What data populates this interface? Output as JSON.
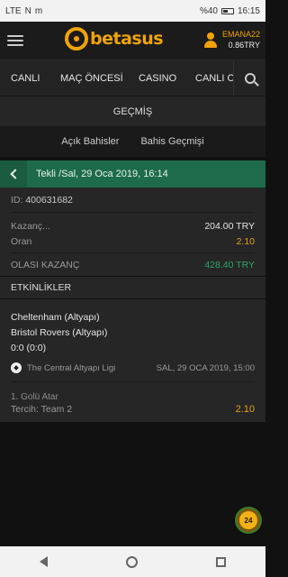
{
  "status_bar": {
    "signal_label": "LTE",
    "nfc": "N",
    "mail": "m",
    "battery": "%40",
    "time": "16:15"
  },
  "header": {
    "logo_text": "betasus",
    "username": "EMANA22",
    "balance": "0.86TRY"
  },
  "nav": {
    "items": [
      {
        "label": "CANLI"
      },
      {
        "label": "MAÇ ÖNCESİ"
      },
      {
        "label": "CASINO"
      },
      {
        "label": "CANLI C"
      }
    ]
  },
  "section_title": "GEÇMİŞ",
  "subtabs": {
    "open_bets": "Açık Bahisler",
    "bet_history": "Bahis Geçmişi"
  },
  "bet": {
    "title": "Tekli /Sal, 29 Oca 2019, 16:14",
    "id_label": "ID:",
    "id_value": "400631682",
    "gain_label": "Kazanç...",
    "gain_value": "204.00 TRY",
    "odds_label": "Oran",
    "odds_value": "2.10",
    "potential_label": "OLASI KAZANÇ",
    "potential_value": "428.40 TRY"
  },
  "events": {
    "heading": "ETKİNLİKLER",
    "items": [
      {
        "home": "Cheltenham (Altyapı)",
        "away": "Bristol Rovers (Altyapı)",
        "score": "0:0 (0:0)",
        "league": "The Central Altyapı Ligi",
        "date": "SAL, 29 OCA 2019, 15:00",
        "market": "1. Golü Atar",
        "selection": "Tercih: Team 2",
        "odd": "2.10"
      }
    ]
  },
  "chat": {
    "label": "24"
  },
  "colors": {
    "brand": "#f0a30a",
    "header_green": "#1d6b4a",
    "potential_green": "#2fa56f",
    "odd_orange": "#e6a117"
  }
}
